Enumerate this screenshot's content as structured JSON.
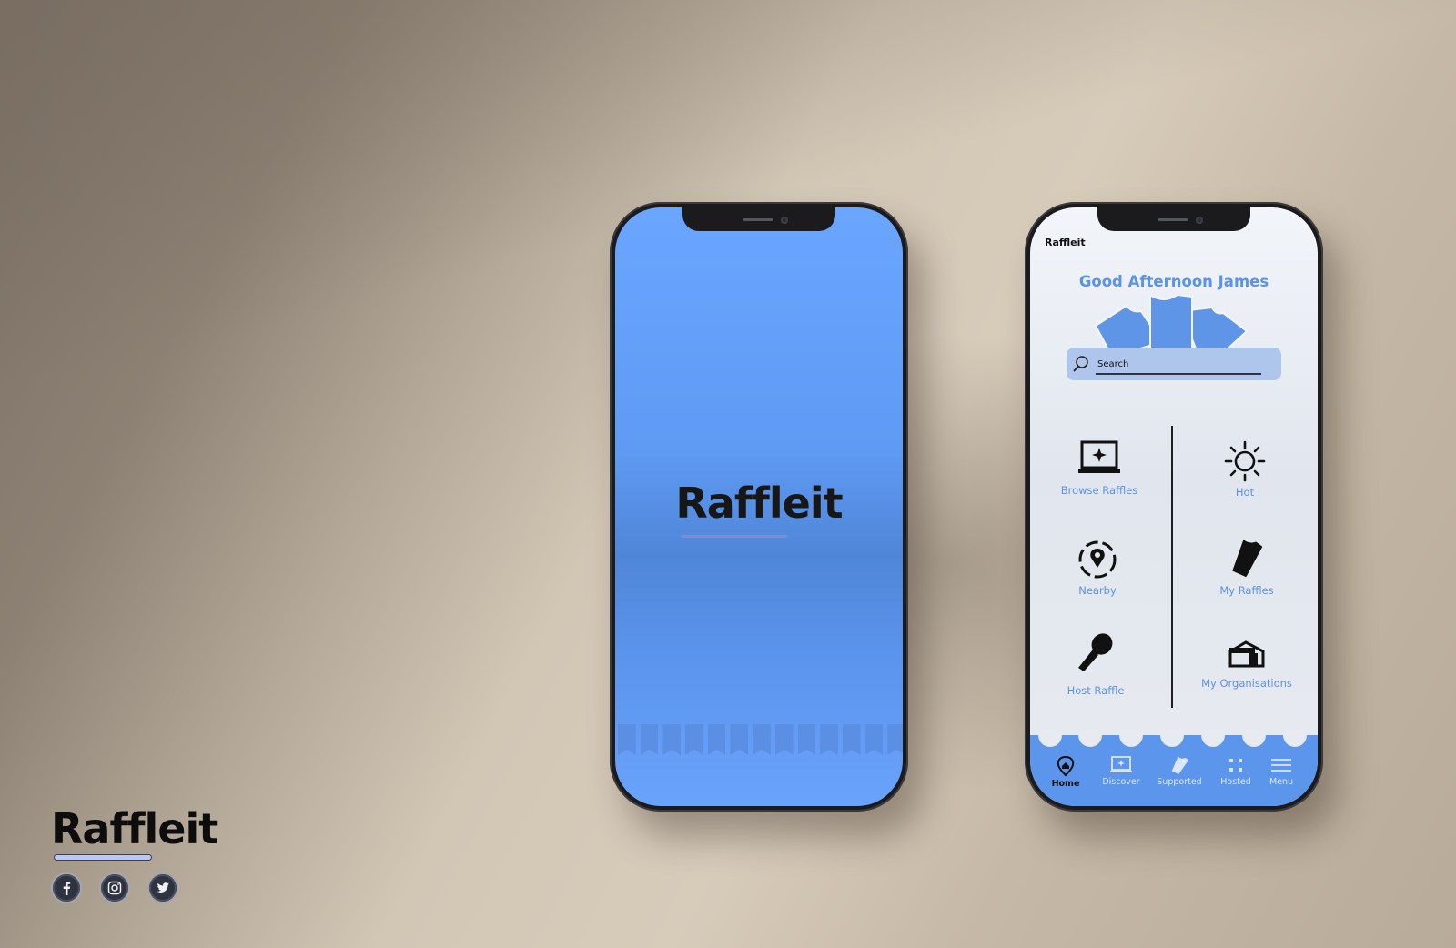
{
  "brand": {
    "name": "Raffleit"
  },
  "splash": {
    "logo_text": "Raffleit"
  },
  "home": {
    "app_label": "Raffleit",
    "greeting": "Good Afternoon James",
    "search_placeholder": "Search",
    "tiles": [
      {
        "label": "Browse Raffles",
        "icon": "laptop-star-icon"
      },
      {
        "label": "Hot",
        "icon": "sun-icon"
      },
      {
        "label": "Nearby",
        "icon": "location-pin-icon"
      },
      {
        "label": "My Raffles",
        "icon": "ticket-icon"
      },
      {
        "label": "Host Raffle",
        "icon": "microphone-icon"
      },
      {
        "label": "My Organisations",
        "icon": "house-icon"
      }
    ],
    "tabs": [
      {
        "label": "Home",
        "icon": "home-pin-icon",
        "active": true
      },
      {
        "label": "Discover",
        "icon": "laptop-star-icon"
      },
      {
        "label": "Supported",
        "icon": "ticket-icon"
      },
      {
        "label": "Hosted",
        "icon": "grid-icon"
      },
      {
        "label": "Menu",
        "icon": "hamburger-icon"
      }
    ]
  },
  "social": [
    "facebook-icon",
    "instagram-icon",
    "twitter-icon"
  ],
  "colors": {
    "accent": "#5b94e6",
    "splash_bg": "#6aa6ff",
    "tabbar": "#5c95ec",
    "background": "#d7cbba"
  }
}
